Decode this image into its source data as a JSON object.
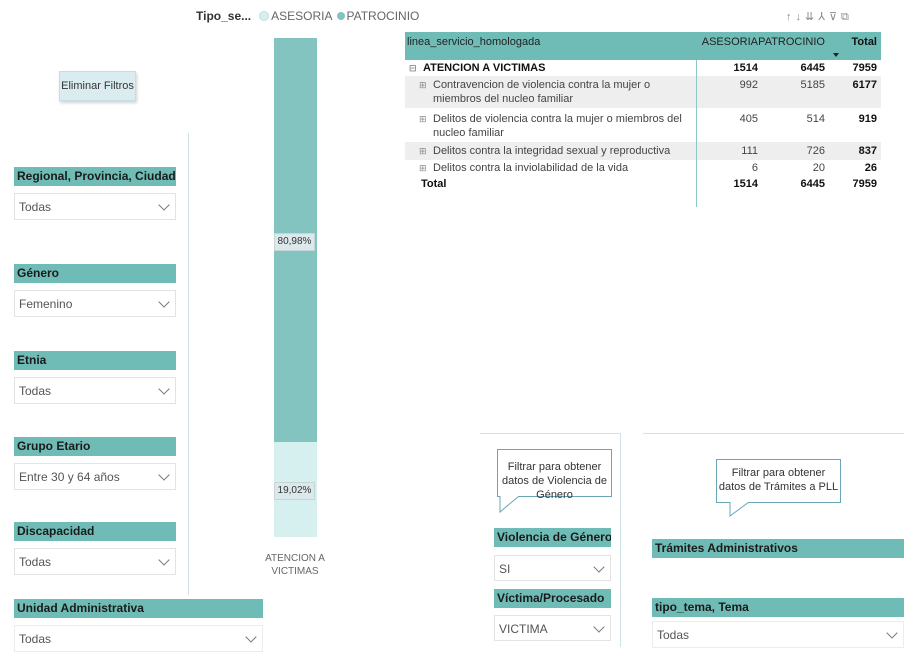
{
  "legend": {
    "title": "Tipo_se...",
    "items": [
      {
        "label": "ASESORIA",
        "color": "#d5f0ef"
      },
      {
        "label": "PATROCINIO",
        "color": "#84c4c0"
      }
    ]
  },
  "clear_filters": {
    "label": "Eliminar Filtros"
  },
  "slicers": {
    "region": {
      "title": "Regional, Provincia, Ciudad",
      "value": "Todas"
    },
    "gender": {
      "title": "Género",
      "value": "Femenino"
    },
    "ethnicity": {
      "title": "Etnia",
      "value": "Todas"
    },
    "age": {
      "title": "Grupo Etario",
      "value": "Entre 30 y 64 años"
    },
    "disability": {
      "title": "Discapacidad",
      "value": "Todas"
    },
    "admin_unit": {
      "title": "Unidad Administrativa",
      "value": "Todas"
    },
    "gender_violence": {
      "title": "Violencia de Género",
      "value": "SI"
    },
    "victim": {
      "title": "Víctima/Procesado",
      "value": "VICTIMA"
    },
    "admin_procedures": {
      "title": "Trámites Administrativos"
    },
    "topic": {
      "title": "tipo_tema, Tema",
      "value": "Todas"
    }
  },
  "chart_data": {
    "type": "bar",
    "stacked": true,
    "normalized": true,
    "categories": [
      "ATENCION A VICTIMAS"
    ],
    "series": [
      {
        "name": "PATROCINIO",
        "values": [
          80.98
        ],
        "label": "80,98%"
      },
      {
        "name": "ASESORIA",
        "values": [
          19.02
        ],
        "label": "19,02%"
      }
    ],
    "ylim": [
      0,
      100
    ]
  },
  "toolbar_icons": [
    "arrow-up-icon",
    "arrow-down-icon",
    "expand-down-icon",
    "hierarchy-icon",
    "filter-icon",
    "focus-mode-icon"
  ],
  "matrix": {
    "headers": [
      "linea_servicio_homologada",
      "ASESORIA",
      "PATROCINIO",
      "Total"
    ],
    "rows": [
      {
        "label": "ATENCION A VICTIMAS",
        "asesoria": "1514",
        "patrocinio": "6445",
        "total": "7959",
        "expander": "⊟"
      },
      {
        "label": "Contravencion de violencia contra la mujer o miembros del nucleo familiar",
        "asesoria": "992",
        "patrocinio": "5185",
        "total": "6177",
        "expander": "⊞"
      },
      {
        "label": "Delitos de violencia contra la mujer o miembros del nucleo familiar",
        "asesoria": "405",
        "patrocinio": "514",
        "total": "919",
        "expander": "⊞"
      },
      {
        "label": "Delitos contra la integridad sexual y reproductiva",
        "asesoria": "111",
        "patrocinio": "726",
        "total": "837",
        "expander": "⊞"
      },
      {
        "label": "Delitos contra la inviolabilidad de la vida",
        "asesoria": "6",
        "patrocinio": "20",
        "total": "26",
        "expander": "⊞"
      }
    ],
    "total": {
      "label": "Total",
      "asesoria": "1514",
      "patrocinio": "6445",
      "total": "7959"
    }
  },
  "callouts": {
    "gender_violence": "Filtrar para obtener datos de Violencia de Género",
    "pll": "Filtrar para obtener datos de Trámites a PLL"
  }
}
